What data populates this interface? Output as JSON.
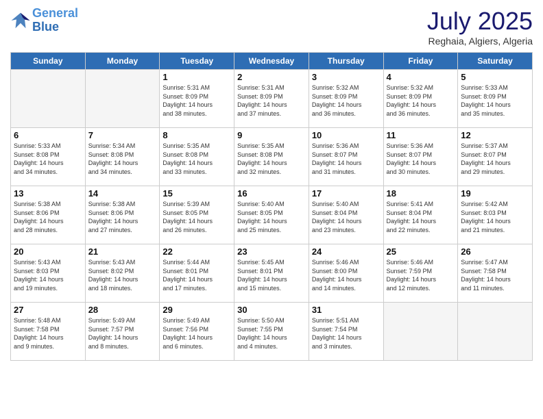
{
  "header": {
    "logo_line1": "General",
    "logo_line2": "Blue",
    "month": "July 2025",
    "location": "Reghaia, Algiers, Algeria"
  },
  "days_of_week": [
    "Sunday",
    "Monday",
    "Tuesday",
    "Wednesday",
    "Thursday",
    "Friday",
    "Saturday"
  ],
  "weeks": [
    [
      {
        "num": "",
        "info": "",
        "empty": true
      },
      {
        "num": "",
        "info": "",
        "empty": true
      },
      {
        "num": "1",
        "info": "Sunrise: 5:31 AM\nSunset: 8:09 PM\nDaylight: 14 hours\nand 38 minutes.",
        "empty": false
      },
      {
        "num": "2",
        "info": "Sunrise: 5:31 AM\nSunset: 8:09 PM\nDaylight: 14 hours\nand 37 minutes.",
        "empty": false
      },
      {
        "num": "3",
        "info": "Sunrise: 5:32 AM\nSunset: 8:09 PM\nDaylight: 14 hours\nand 36 minutes.",
        "empty": false
      },
      {
        "num": "4",
        "info": "Sunrise: 5:32 AM\nSunset: 8:09 PM\nDaylight: 14 hours\nand 36 minutes.",
        "empty": false
      },
      {
        "num": "5",
        "info": "Sunrise: 5:33 AM\nSunset: 8:09 PM\nDaylight: 14 hours\nand 35 minutes.",
        "empty": false
      }
    ],
    [
      {
        "num": "6",
        "info": "Sunrise: 5:33 AM\nSunset: 8:08 PM\nDaylight: 14 hours\nand 34 minutes.",
        "empty": false
      },
      {
        "num": "7",
        "info": "Sunrise: 5:34 AM\nSunset: 8:08 PM\nDaylight: 14 hours\nand 34 minutes.",
        "empty": false
      },
      {
        "num": "8",
        "info": "Sunrise: 5:35 AM\nSunset: 8:08 PM\nDaylight: 14 hours\nand 33 minutes.",
        "empty": false
      },
      {
        "num": "9",
        "info": "Sunrise: 5:35 AM\nSunset: 8:08 PM\nDaylight: 14 hours\nand 32 minutes.",
        "empty": false
      },
      {
        "num": "10",
        "info": "Sunrise: 5:36 AM\nSunset: 8:07 PM\nDaylight: 14 hours\nand 31 minutes.",
        "empty": false
      },
      {
        "num": "11",
        "info": "Sunrise: 5:36 AM\nSunset: 8:07 PM\nDaylight: 14 hours\nand 30 minutes.",
        "empty": false
      },
      {
        "num": "12",
        "info": "Sunrise: 5:37 AM\nSunset: 8:07 PM\nDaylight: 14 hours\nand 29 minutes.",
        "empty": false
      }
    ],
    [
      {
        "num": "13",
        "info": "Sunrise: 5:38 AM\nSunset: 8:06 PM\nDaylight: 14 hours\nand 28 minutes.",
        "empty": false
      },
      {
        "num": "14",
        "info": "Sunrise: 5:38 AM\nSunset: 8:06 PM\nDaylight: 14 hours\nand 27 minutes.",
        "empty": false
      },
      {
        "num": "15",
        "info": "Sunrise: 5:39 AM\nSunset: 8:05 PM\nDaylight: 14 hours\nand 26 minutes.",
        "empty": false
      },
      {
        "num": "16",
        "info": "Sunrise: 5:40 AM\nSunset: 8:05 PM\nDaylight: 14 hours\nand 25 minutes.",
        "empty": false
      },
      {
        "num": "17",
        "info": "Sunrise: 5:40 AM\nSunset: 8:04 PM\nDaylight: 14 hours\nand 23 minutes.",
        "empty": false
      },
      {
        "num": "18",
        "info": "Sunrise: 5:41 AM\nSunset: 8:04 PM\nDaylight: 14 hours\nand 22 minutes.",
        "empty": false
      },
      {
        "num": "19",
        "info": "Sunrise: 5:42 AM\nSunset: 8:03 PM\nDaylight: 14 hours\nand 21 minutes.",
        "empty": false
      }
    ],
    [
      {
        "num": "20",
        "info": "Sunrise: 5:43 AM\nSunset: 8:03 PM\nDaylight: 14 hours\nand 19 minutes.",
        "empty": false
      },
      {
        "num": "21",
        "info": "Sunrise: 5:43 AM\nSunset: 8:02 PM\nDaylight: 14 hours\nand 18 minutes.",
        "empty": false
      },
      {
        "num": "22",
        "info": "Sunrise: 5:44 AM\nSunset: 8:01 PM\nDaylight: 14 hours\nand 17 minutes.",
        "empty": false
      },
      {
        "num": "23",
        "info": "Sunrise: 5:45 AM\nSunset: 8:01 PM\nDaylight: 14 hours\nand 15 minutes.",
        "empty": false
      },
      {
        "num": "24",
        "info": "Sunrise: 5:46 AM\nSunset: 8:00 PM\nDaylight: 14 hours\nand 14 minutes.",
        "empty": false
      },
      {
        "num": "25",
        "info": "Sunrise: 5:46 AM\nSunset: 7:59 PM\nDaylight: 14 hours\nand 12 minutes.",
        "empty": false
      },
      {
        "num": "26",
        "info": "Sunrise: 5:47 AM\nSunset: 7:58 PM\nDaylight: 14 hours\nand 11 minutes.",
        "empty": false
      }
    ],
    [
      {
        "num": "27",
        "info": "Sunrise: 5:48 AM\nSunset: 7:58 PM\nDaylight: 14 hours\nand 9 minutes.",
        "empty": false
      },
      {
        "num": "28",
        "info": "Sunrise: 5:49 AM\nSunset: 7:57 PM\nDaylight: 14 hours\nand 8 minutes.",
        "empty": false
      },
      {
        "num": "29",
        "info": "Sunrise: 5:49 AM\nSunset: 7:56 PM\nDaylight: 14 hours\nand 6 minutes.",
        "empty": false
      },
      {
        "num": "30",
        "info": "Sunrise: 5:50 AM\nSunset: 7:55 PM\nDaylight: 14 hours\nand 4 minutes.",
        "empty": false
      },
      {
        "num": "31",
        "info": "Sunrise: 5:51 AM\nSunset: 7:54 PM\nDaylight: 14 hours\nand 3 minutes.",
        "empty": false
      },
      {
        "num": "",
        "info": "",
        "empty": true
      },
      {
        "num": "",
        "info": "",
        "empty": true
      }
    ]
  ]
}
